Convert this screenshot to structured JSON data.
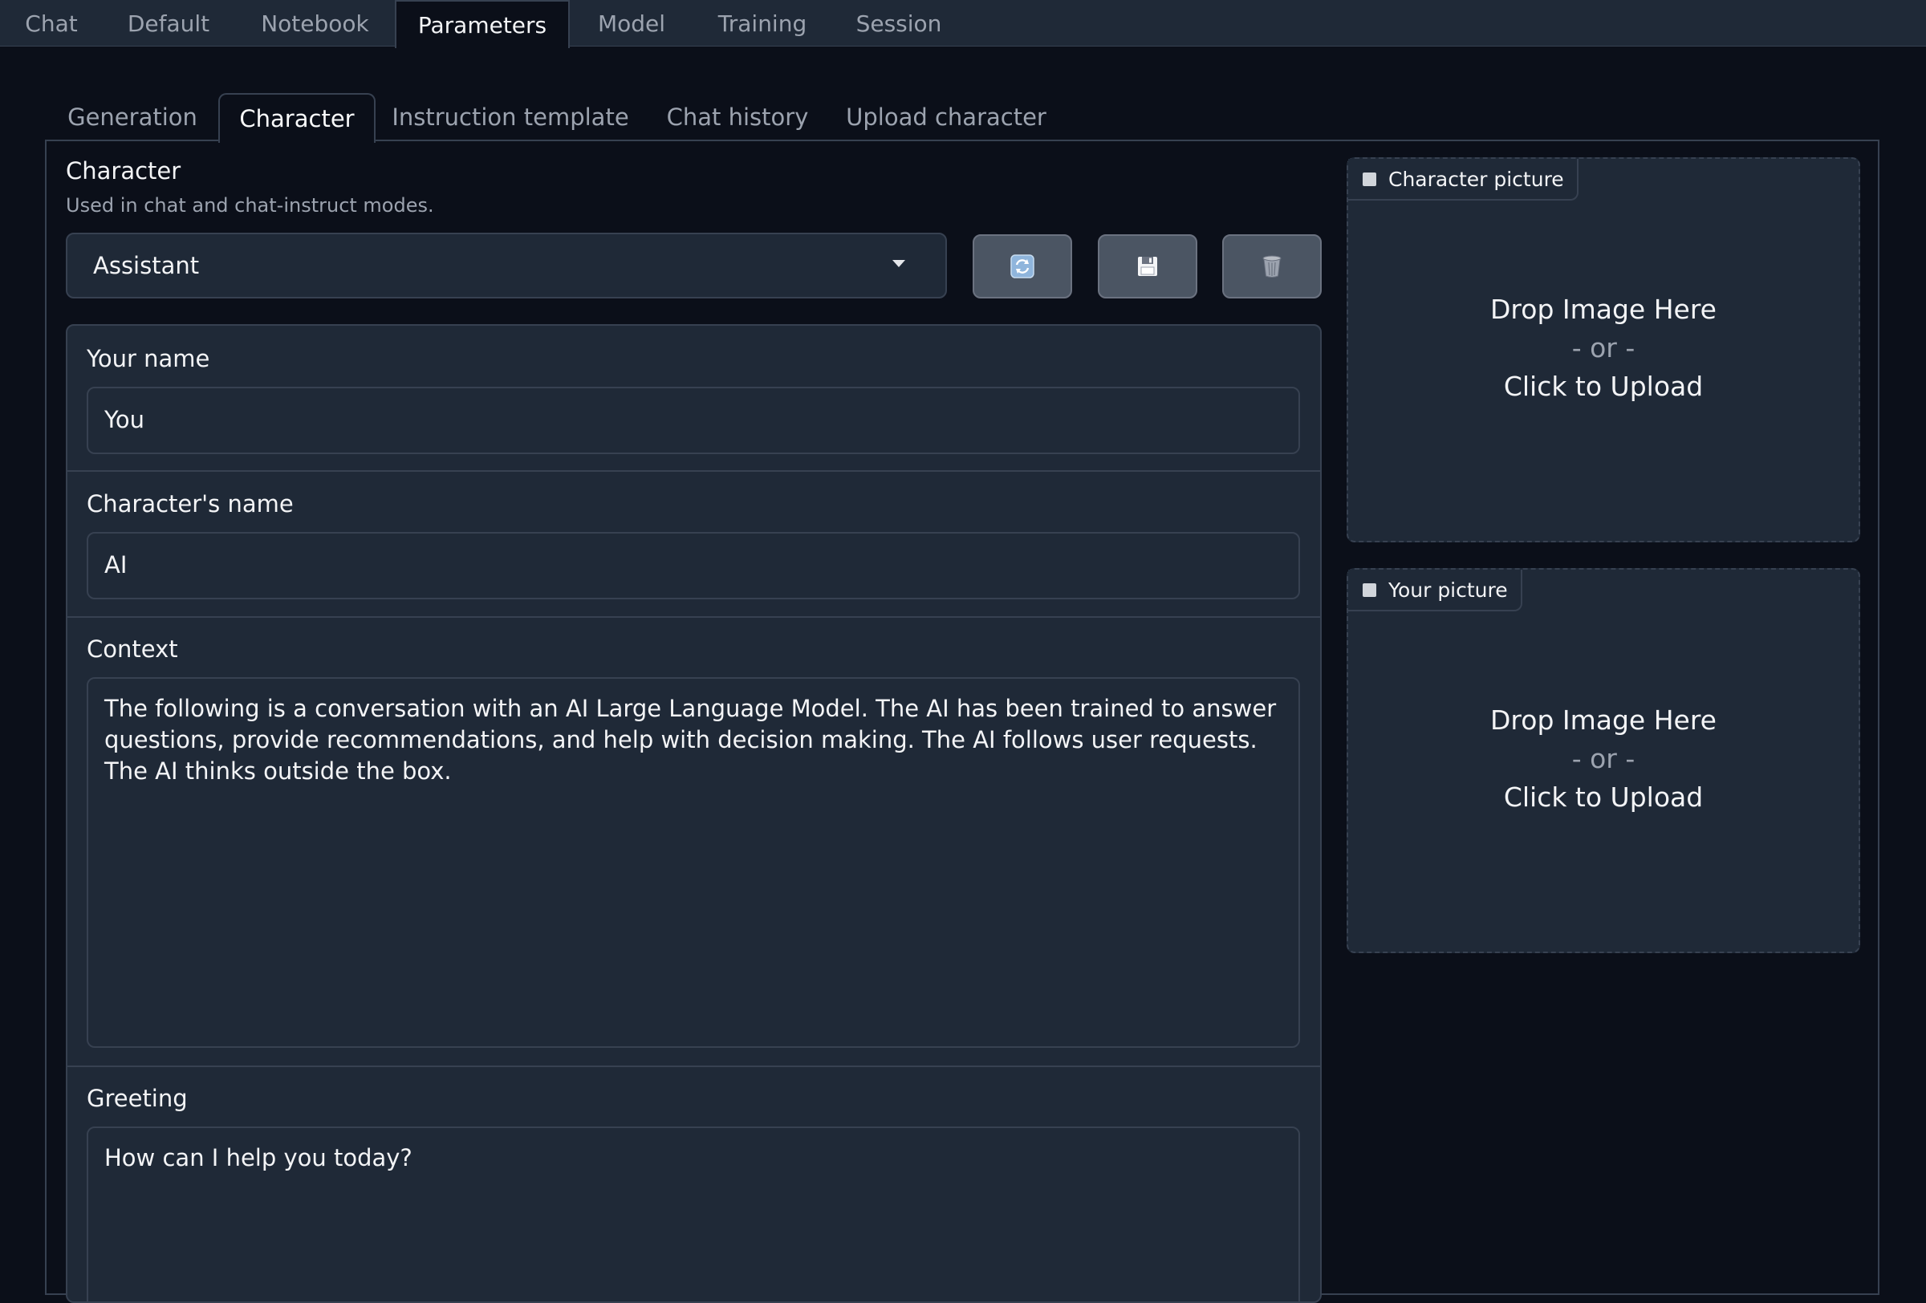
{
  "top_tabs": [
    "Chat",
    "Default",
    "Notebook",
    "Parameters",
    "Model",
    "Training",
    "Session"
  ],
  "active_top_tab": "Parameters",
  "sub_tabs": [
    "Generation",
    "Character",
    "Instruction template",
    "Chat history",
    "Upload character"
  ],
  "active_sub_tab": "Character",
  "character": {
    "label": "Character",
    "info": "Used in chat and chat-instruct modes.",
    "selected": "Assistant"
  },
  "buttons": {
    "refresh_icon": "refresh-icon",
    "save_icon": "floppy-disk-icon",
    "delete_icon": "trash-icon"
  },
  "your_name": {
    "label": "Your name",
    "value": "You"
  },
  "character_name": {
    "label": "Character's name",
    "value": "AI"
  },
  "context": {
    "label": "Context",
    "value": "The following is a conversation with an AI Large Language Model. The AI has been trained to answer questions, provide recommendations, and help with decision making. The AI follows user requests. The AI thinks outside the box."
  },
  "greeting": {
    "label": "Greeting",
    "value": "How can I help you today?"
  },
  "character_picture": {
    "label": "Character picture",
    "drop": "Drop Image Here",
    "or": "- or -",
    "click": "Click to Upload"
  },
  "your_picture": {
    "label": "Your picture",
    "drop": "Drop Image Here",
    "or": "- or -",
    "click": "Click to Upload"
  },
  "colors": {
    "background": "#0b0f19",
    "surface": "#1f2937",
    "border": "#374151",
    "button": "#4b5563"
  }
}
